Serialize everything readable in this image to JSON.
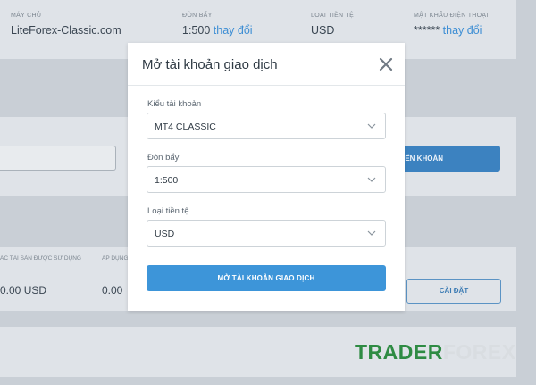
{
  "account_info": {
    "server": {
      "label": "MÁY CHỦ",
      "value": "LiteForex-Classic.com"
    },
    "leverage": {
      "label": "ĐÒN BẨY",
      "value": "1:500",
      "link": "thay đổi"
    },
    "currency": {
      "label": "LOẠI TIỀN TỆ",
      "value": "USD"
    },
    "phone_password": {
      "label": "MẬT KHẨU ĐIỆN THOẠI",
      "value": "******",
      "link": "thay đổi"
    }
  },
  "background": {
    "transfer_button": "ỂN KHOẢN",
    "columns": [
      {
        "header": "ÁC TÀI SẢN ĐƯỢC SỬ DỤNG",
        "value": "0.00 USD"
      },
      {
        "header": "ÁP DỤNG",
        "value": "0.00"
      }
    ],
    "settings_button": "CÀI ĐẶT"
  },
  "watermark": {
    "part1": "TRADER",
    "part2": "FOREX"
  },
  "modal": {
    "title": "Mở tài khoản giao dịch",
    "account_type": {
      "label": "Kiểu tài khoản",
      "value": "MT4 CLASSIC"
    },
    "leverage": {
      "label": "Đòn bẩy",
      "value": "1:500"
    },
    "currency": {
      "label": "Loại tiền tệ",
      "value": "USD"
    },
    "submit_label": "MỞ TÀI KHOẢN GIAO DỊCH"
  },
  "colors": {
    "primary": "#3d95d9",
    "overlay": "#c9cfd6",
    "watermark_green": "#2e8b43"
  }
}
